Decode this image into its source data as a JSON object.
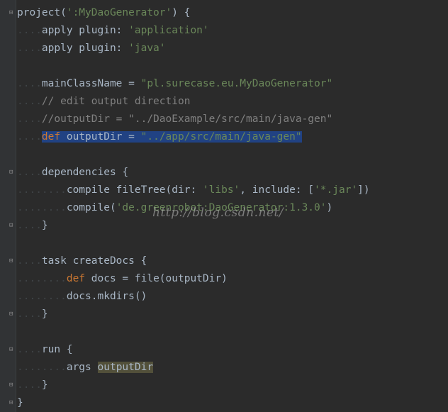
{
  "editor": {
    "lines": [
      {
        "t": [
          {
            "c": "",
            "s": "ws"
          },
          {
            "c": "project(",
            "s": ""
          },
          {
            "c": "':MyDaoGenerator'",
            "s": "str"
          },
          {
            "c": ") {",
            "s": ""
          }
        ]
      },
      {
        "t": [
          {
            "c": "....",
            "s": "ws"
          },
          {
            "c": "apply plugin: ",
            "s": ""
          },
          {
            "c": "'application'",
            "s": "str"
          }
        ]
      },
      {
        "t": [
          {
            "c": "....",
            "s": "ws"
          },
          {
            "c": "apply plugin: ",
            "s": ""
          },
          {
            "c": "'java'",
            "s": "str"
          }
        ]
      },
      {
        "t": []
      },
      {
        "t": [
          {
            "c": "....",
            "s": "ws"
          },
          {
            "c": "mainClassName = ",
            "s": ""
          },
          {
            "c": "\"pl.surecase.eu.MyDaoGenerator\"",
            "s": "str"
          }
        ]
      },
      {
        "t": [
          {
            "c": "....",
            "s": "ws"
          },
          {
            "c": "// edit output direction",
            "s": "cm"
          }
        ]
      },
      {
        "t": [
          {
            "c": "....",
            "s": "ws"
          },
          {
            "c": "//outputDir = \"../DaoExample/src/main/java-gen\"",
            "s": "cm"
          }
        ]
      },
      {
        "t": [
          {
            "c": "....",
            "s": "ws"
          },
          {
            "c": "def",
            "s": "kw sel"
          },
          {
            "c": " outputDir = ",
            "s": "sel"
          },
          {
            "c": "\"../app/src/main/java-gen\"",
            "s": "str sel"
          }
        ]
      },
      {
        "t": []
      },
      {
        "t": [
          {
            "c": "....",
            "s": "ws"
          },
          {
            "c": "dependencies {",
            "s": ""
          }
        ]
      },
      {
        "t": [
          {
            "c": "........",
            "s": "ws"
          },
          {
            "c": "compile fileTree(dir: ",
            "s": ""
          },
          {
            "c": "'libs'",
            "s": "str"
          },
          {
            "c": ", include: [",
            "s": ""
          },
          {
            "c": "'*.jar'",
            "s": "str"
          },
          {
            "c": "])",
            "s": ""
          }
        ]
      },
      {
        "t": [
          {
            "c": "........",
            "s": "ws"
          },
          {
            "c": "compile(",
            "s": ""
          },
          {
            "c": "'de.greenrobot:DaoGenerator:1.3.0'",
            "s": "str"
          },
          {
            "c": ")",
            "s": ""
          }
        ]
      },
      {
        "t": [
          {
            "c": "....",
            "s": "ws"
          },
          {
            "c": "}",
            "s": ""
          }
        ]
      },
      {
        "t": []
      },
      {
        "t": [
          {
            "c": "....",
            "s": "ws"
          },
          {
            "c": "task createDocs {",
            "s": ""
          }
        ]
      },
      {
        "t": [
          {
            "c": "........",
            "s": "ws"
          },
          {
            "c": "def",
            "s": "kw"
          },
          {
            "c": " docs = file(outputDir)",
            "s": ""
          }
        ]
      },
      {
        "t": [
          {
            "c": "........",
            "s": "ws"
          },
          {
            "c": "docs.mkdirs()",
            "s": ""
          }
        ]
      },
      {
        "t": [
          {
            "c": "....",
            "s": "ws"
          },
          {
            "c": "}",
            "s": ""
          }
        ]
      },
      {
        "t": []
      },
      {
        "t": [
          {
            "c": "....",
            "s": "ws"
          },
          {
            "c": "run {",
            "s": ""
          }
        ]
      },
      {
        "t": [
          {
            "c": "........",
            "s": "ws"
          },
          {
            "c": "args ",
            "s": ""
          },
          {
            "c": "outputDir",
            "s": "usage"
          }
        ]
      },
      {
        "t": [
          {
            "c": "....",
            "s": "ws"
          },
          {
            "c": "}",
            "s": ""
          }
        ]
      },
      {
        "t": [
          {
            "c": "}",
            "s": ""
          }
        ]
      }
    ]
  },
  "watermark": "http://blog.csdn.net/"
}
